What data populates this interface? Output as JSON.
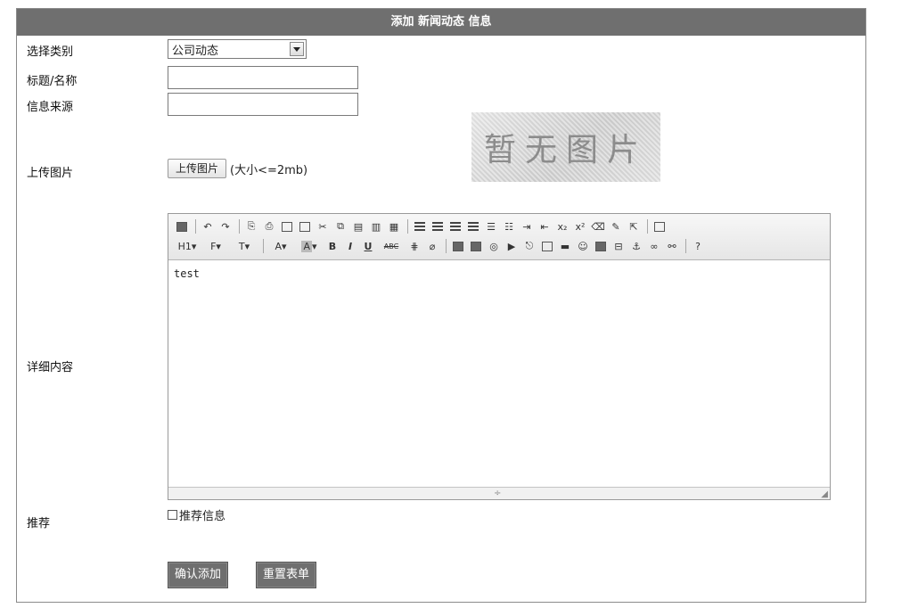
{
  "header": {
    "title": "添加 新闻动态 信息"
  },
  "form": {
    "category": {
      "label": "选择类别",
      "value": "公司动态"
    },
    "title_field": {
      "label": "标题/名称",
      "value": ""
    },
    "source_field": {
      "label": "信息来源",
      "value": ""
    },
    "upload": {
      "label": "上传图片",
      "button": "上传图片",
      "note": "(大小<=2mb)",
      "preview_text": "暂无图片"
    },
    "content": {
      "label": "详细内容",
      "text": "test",
      "toolbar_row2": {
        "heading": "H1",
        "font": "F",
        "size": "T",
        "forecolor": "A",
        "bgcolor": "A",
        "bold": "B",
        "italic": "I",
        "underline": "U",
        "strike": "ABC"
      }
    },
    "recommend": {
      "label": "推荐",
      "checkbox_label": "推荐信息",
      "checked": false
    },
    "buttons": {
      "submit": "确认添加",
      "reset": "重置表单"
    }
  }
}
